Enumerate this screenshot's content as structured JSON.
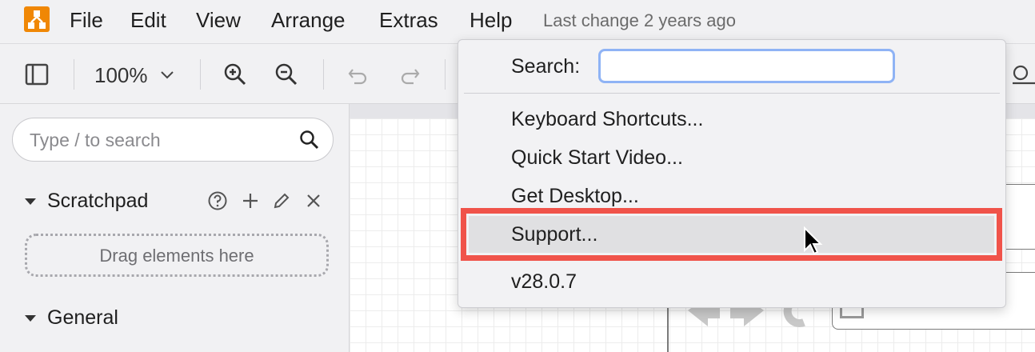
{
  "menubar": {
    "items": [
      "File",
      "Edit",
      "View",
      "Arrange",
      "Extras",
      "Help"
    ],
    "last_change": "Last change 2 years ago"
  },
  "toolbar": {
    "zoom": "100%"
  },
  "sidebar": {
    "search_placeholder": "Type / to search",
    "scratchpad_title": "Scratchpad",
    "drop_text": "Drag elements here",
    "general_title": "General"
  },
  "help_menu": {
    "search_label": "Search:",
    "search_value": "",
    "items": [
      "Keyboard Shortcuts...",
      "Quick Start Video...",
      "Get Desktop...",
      "Support..."
    ],
    "version": "v28.0.7"
  },
  "colors": {
    "logo": "#f08705",
    "highlight": "#f0534a",
    "input_focus": "#8fb3f5"
  }
}
